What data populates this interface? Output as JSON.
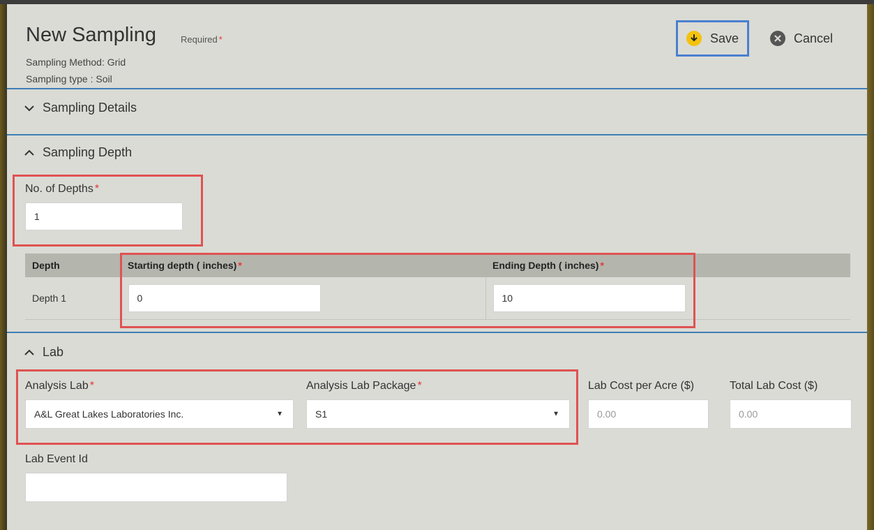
{
  "header": {
    "title": "New Sampling",
    "required_note": "Required",
    "sampling_method": "Sampling Method: Grid",
    "sampling_type": "Sampling type : Soil",
    "save_label": "Save",
    "cancel_label": "Cancel"
  },
  "sections": {
    "details": "Sampling Details",
    "depth": "Sampling Depth",
    "lab": "Lab"
  },
  "depth": {
    "num_depths_label": "No. of Depths",
    "num_depths_value": "1",
    "table": {
      "headers": [
        "Depth",
        "Starting depth ( inches)",
        "Ending Depth ( inches)"
      ],
      "rows": [
        {
          "depth": "Depth 1",
          "start": "0",
          "end": "10"
        }
      ]
    }
  },
  "lab": {
    "analysis_lab_label": "Analysis Lab",
    "analysis_lab_value": "A&L Great Lakes Laboratories Inc.",
    "package_label": "Analysis Lab Package",
    "package_value": "S1",
    "cost_per_acre_label": "Lab Cost per Acre ($)",
    "cost_per_acre_value": "0.00",
    "total_cost_label": "Total Lab Cost ($)",
    "total_cost_value": "0.00",
    "event_id_label": "Lab Event Id",
    "event_id_value": ""
  },
  "colors": {
    "accent_rule": "#3e7fb5",
    "highlight_red": "#e05252",
    "highlight_blue": "#4a7fd0",
    "required_star": "#e53935",
    "save_icon": "#f4c20d"
  }
}
